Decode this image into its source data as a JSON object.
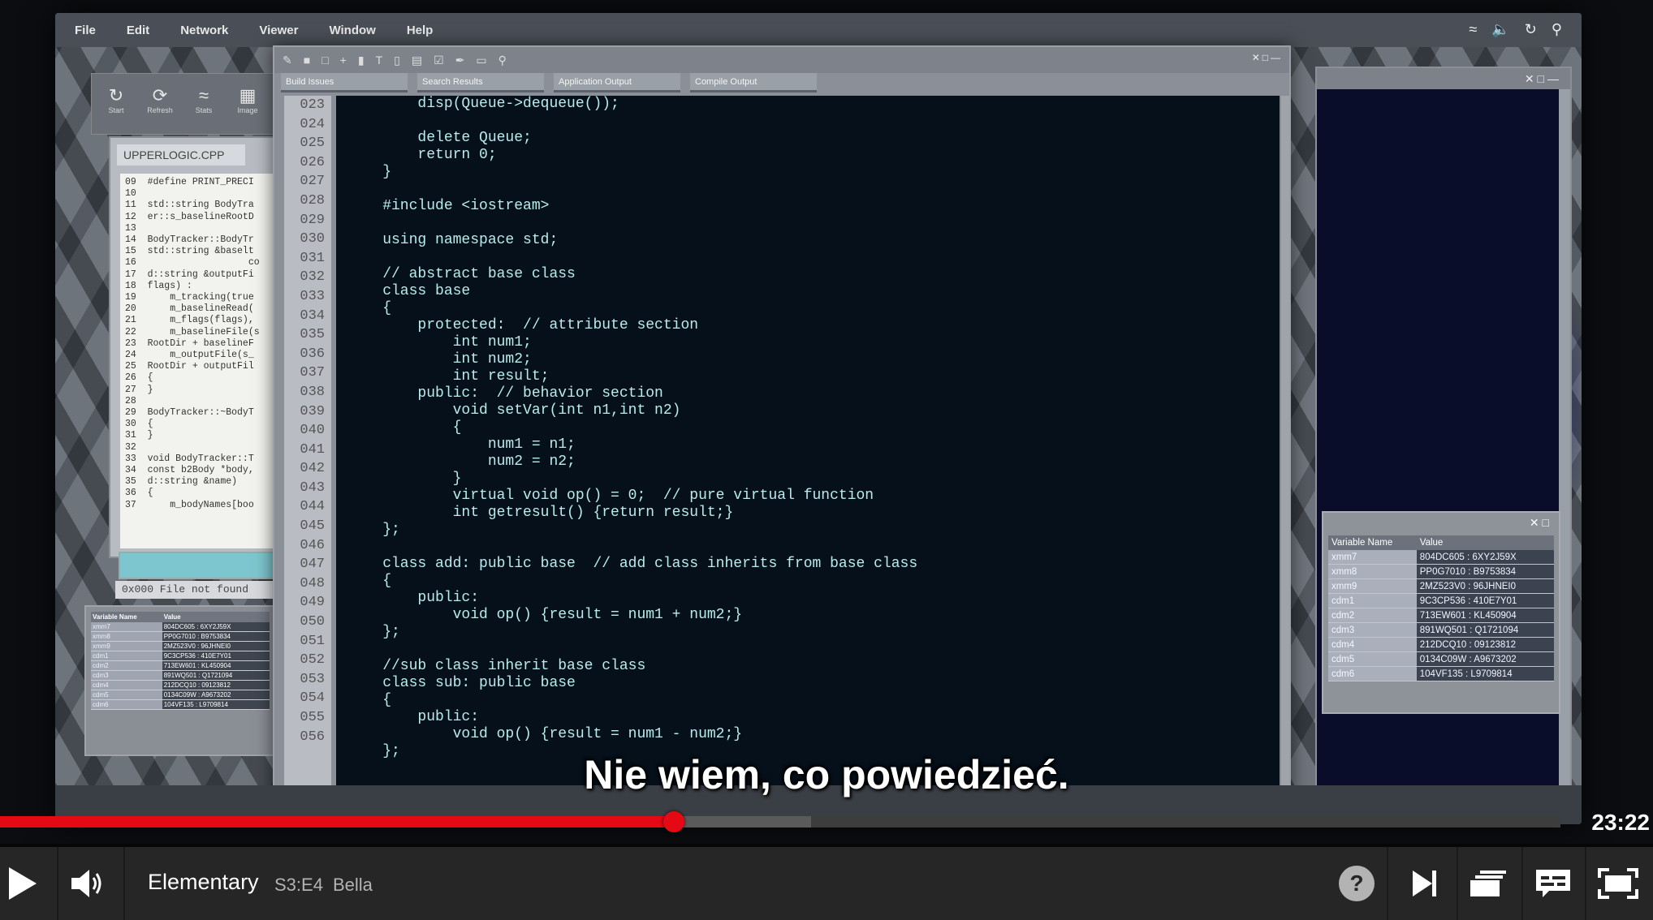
{
  "video": {
    "desktop_menu": [
      "File",
      "Edit",
      "Network",
      "Viewer",
      "Window",
      "Help"
    ],
    "toolbar_buttons": [
      "Start",
      "Refresh",
      "Stats",
      "Image"
    ],
    "file_tab": "UPPERLOGIC.CPP",
    "file_code": "09  #define PRINT_PRECI\n10\n11  std::string BodyTra\n12  er::s_baselineRootD\n13\n14  BodyTracker::BodyTr\n15  std::string &baselt\n16                    co\n17  d::string &outputFi\n18  flags) :\n19      m_tracking(true\n20      m_baselineRead(\n21      m_flags(flags),\n22      m_baselineFile(s\n23  RootDir + baselineF\n24      m_outputFile(s_\n25  RootDir + outputFil\n26  {\n27  }\n28\n29  BodyTracker::~BodyT\n30  {\n31  }\n32\n33  void BodyTracker::T\n34  const b2Body *body,\n35  d::string &name)\n36  {\n37      m_bodyNames[boo",
    "status_message": "0x000 File not found",
    "editor_tabs": [
      "Build Issues",
      "Search Results",
      "Application Output",
      "Compile Output"
    ],
    "line_numbers": [
      "023",
      "024",
      "025",
      "026",
      "027",
      "028",
      "029",
      "030",
      "031",
      "032",
      "033",
      "034",
      "035",
      "036",
      "037",
      "038",
      "039",
      "040",
      "041",
      "042",
      "043",
      "044",
      "045",
      "046",
      "047",
      "048",
      "049",
      "050",
      "051",
      "052",
      "053",
      "054",
      "055",
      "056"
    ],
    "code_lines": [
      "        disp(Queue->dequeue());",
      "",
      "        delete Queue;",
      "        return 0;",
      "    }",
      "",
      "    #include <iostream>",
      "",
      "    using namespace std;",
      "",
      "    // abstract base class",
      "    class base",
      "    {",
      "        protected:  // attribute section",
      "            int num1;",
      "            int num2;",
      "            int result;",
      "        public:  // behavior section",
      "            void setVar(int n1,int n2)",
      "            {",
      "                num1 = n1;",
      "                num2 = n2;",
      "            }",
      "            virtual void op() = 0;  // pure virtual function",
      "            int getresult() {return result;}",
      "    };",
      "",
      "    class add: public base  // add class inherits from base class",
      "    {",
      "        public:",
      "            void op() {result = num1 + num2;}",
      "    };",
      "",
      "    //sub class inherit base class",
      "    class sub: public base",
      "    {",
      "        public:",
      "            void op() {result = num1 - num2;}",
      "    };"
    ],
    "variables": {
      "headers": [
        "Variable Name",
        "Value"
      ],
      "rows": [
        [
          "xmm7",
          "804DC605 : 6XY2J59X"
        ],
        [
          "xmm8",
          "PP0G7010 : B9753834"
        ],
        [
          "xmm9",
          "2MZ523V0 : 96JHNEI0"
        ],
        [
          "cdm1",
          "9C3CP536 : 410E7Y01"
        ],
        [
          "cdm2",
          "713EW601 : KL450904"
        ],
        [
          "cdm3",
          "891WQ501 : Q1721094"
        ],
        [
          "cdm4",
          "212DCQ10 : 09123812"
        ],
        [
          "cdm5",
          "0134C09W : A9673202"
        ],
        [
          "cdm6",
          "104VF135 : L9709814"
        ]
      ]
    },
    "subtitle": "Nie wiem, co powiedzieć."
  },
  "player": {
    "time_remaining": "23:22",
    "progress_fraction": 0.432,
    "buffered_fraction": 0.52,
    "accent_color": "#e50914",
    "show_title": "Elementary",
    "episode_code": "S3:E4",
    "episode_title": "Bella",
    "icons": [
      "play-icon",
      "volume-icon",
      "help-icon",
      "next-episode-icon",
      "episodes-icon",
      "subtitles-icon",
      "fullscreen-icon"
    ]
  }
}
